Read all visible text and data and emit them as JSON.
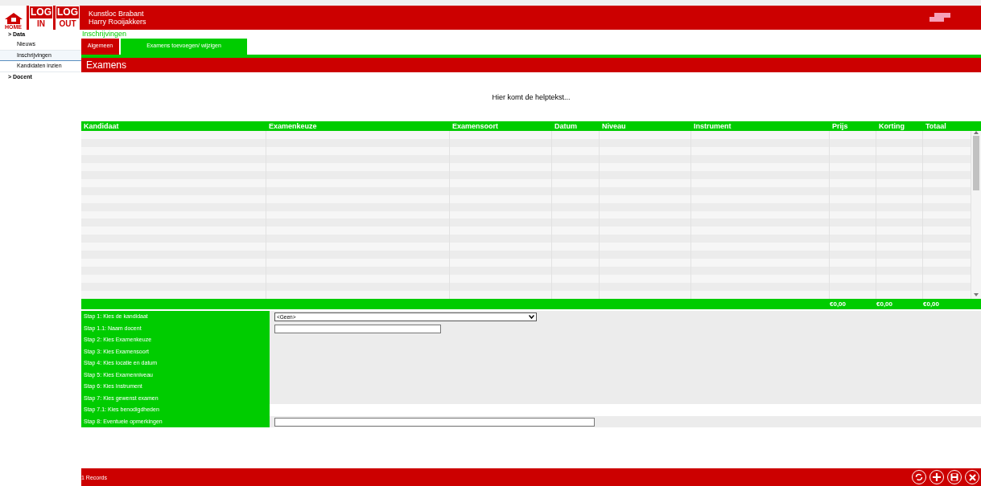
{
  "header": {
    "buttons": [
      {
        "kind": "home",
        "label": "HOME"
      },
      {
        "kind": "log",
        "top": "LOG",
        "bottom": "IN"
      },
      {
        "kind": "log",
        "top": "LOG",
        "bottom": "OUT"
      }
    ],
    "organisation": "Kunstloc Brabant",
    "user": "Harry Rooijakkers"
  },
  "sidebar": {
    "items": [
      {
        "label": "> Data",
        "children": [
          {
            "label": "Nieuws",
            "selected": false
          },
          {
            "label": "Inschrijvingen",
            "selected": true
          },
          {
            "label": "Kandidaten inzien",
            "selected": false
          }
        ]
      },
      {
        "label": "> Docent"
      }
    ]
  },
  "breadcrumb": "Inschrijvingen",
  "tabs": [
    {
      "label": "Algemeen",
      "selected": false
    },
    {
      "label": "Examens toevoegen/ wijzigen",
      "selected": true
    }
  ],
  "section_title": "Examens",
  "help_text": "Hier komt de helptekst...",
  "table": {
    "columns": [
      "Kandidaat",
      "Examenkeuze",
      "Examensoort",
      "Datum",
      "Niveau",
      "Instrument",
      "Prijs",
      "Korting",
      "Totaal"
    ],
    "totals": [
      "€0,00",
      "€0,00",
      "€0,00"
    ]
  },
  "steps": [
    {
      "label": "Stap 1: Kies de kandidaat",
      "kind": "select",
      "value": "<Geen>",
      "shaded": true
    },
    {
      "label": "Stap 1.1: Naam docent",
      "kind": "short-input",
      "shaded": true
    },
    {
      "label": "Stap 2: Kies Examenkeuze",
      "kind": "none",
      "shaded": true
    },
    {
      "label": "Stap 3: Kies Examensoort",
      "kind": "none",
      "shaded": true
    },
    {
      "label": "Stap 4: Kies locatie en datum",
      "kind": "none",
      "shaded": true
    },
    {
      "label": "Stap 5: Kies Examenniveau",
      "kind": "none",
      "shaded": true
    },
    {
      "label": "Stap 6: Kies Instrument",
      "kind": "none",
      "shaded": true
    },
    {
      "label": "Stap 7: Kies gewenst examen",
      "kind": "none",
      "shaded": true
    },
    {
      "label": "Stap 7.1: Kies benodigdheden",
      "kind": "none",
      "shaded": false
    },
    {
      "label": "Stap 8: Eventuele opmerkingen",
      "kind": "long-input",
      "shaded": true
    }
  ],
  "footer": {
    "records": "1 Records"
  }
}
